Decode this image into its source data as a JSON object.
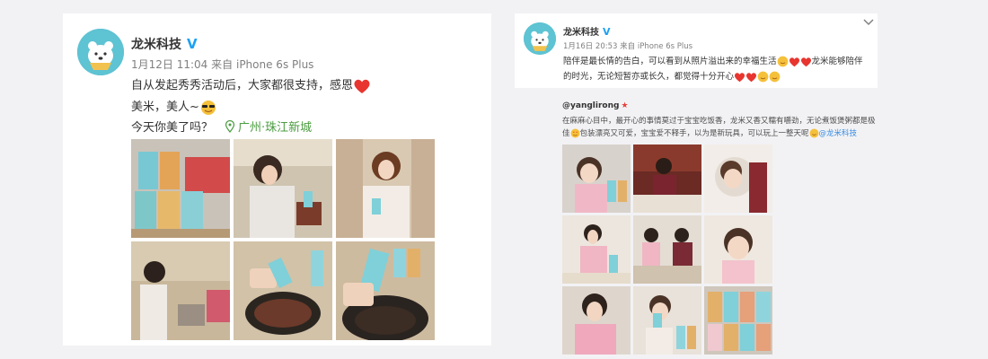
{
  "post1": {
    "username": "龙米科技",
    "verified_mark": "V",
    "time": "1月12日 11:04",
    "source_prefix": "来自",
    "source": "iPhone 6s Plus",
    "line1": "自从发起秀秀活动后，大家都很支持，感恩",
    "line2": "美米，美人~",
    "line3": "今天你美了吗？",
    "location": "广州·珠江新城",
    "photos": [
      "cans",
      "woman-cooking",
      "woman-holding-can",
      "woman-kitchen",
      "pouring-can",
      "pot-closeup"
    ]
  },
  "post2": {
    "username": "龙米科技",
    "verified_mark": "V",
    "time": "1月16日 20:53",
    "source_prefix": "来自",
    "source": "iPhone 6s Plus",
    "text_line1": "陪伴是最长情的告白，可以看到从照片溢出来的幸福生活",
    "text_line1_tail": "龙米能够陪伴",
    "text_line2": "的时光，无论短暂亦或长久，都觉得十分开心",
    "quote": {
      "username": "@yanglirong",
      "line1": "在麻麻心目中，最开心的事情莫过于宝宝吃饭香，龙米又香又糯有嚼劲，无论煮饭煲粥都是极",
      "line2_head": "佳",
      "line2": "包装漂亮又可爱，宝宝爱不释手，以为是新玩具，可以玩上一整天呢",
      "line2_link": "@龙米科技"
    },
    "photos": [
      "baby-smiling",
      "father-child",
      "baby-profile",
      "mother-feeding",
      "family-table",
      "baby-close",
      "mother-smile",
      "baby-cans",
      "can-lineup"
    ]
  },
  "icons": {
    "heart": "heart-icon",
    "cool": "sunglasses-emoji-icon",
    "pin": "location-pin-icon",
    "chevron": "chevron-down-icon"
  }
}
